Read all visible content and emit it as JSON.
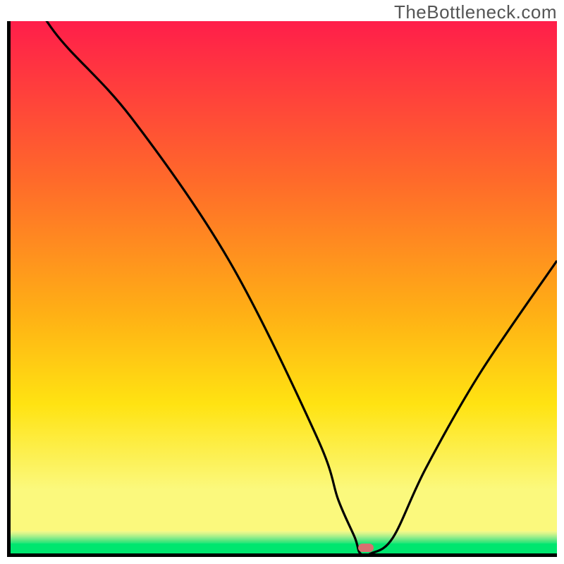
{
  "watermark": "TheBottleneck.com",
  "colors": {
    "gradient_top": "#ff1e4a",
    "gradient_mid1": "#ff6a2a",
    "gradient_mid2": "#ffb015",
    "gradient_mid3": "#ffe312",
    "gradient_bottom_yellow": "#fbf97d",
    "green_band": "#00e66f",
    "marker": "#d87070",
    "axis": "#000000"
  },
  "chart_data": {
    "type": "line",
    "title": "",
    "xlabel": "",
    "ylabel": "",
    "xlim": [
      0,
      100
    ],
    "ylim": [
      0,
      100
    ],
    "x": [
      0,
      8,
      22,
      40,
      56,
      60,
      63,
      64,
      66,
      70,
      76,
      86,
      100
    ],
    "values": [
      112,
      98,
      82,
      55,
      22,
      10,
      3,
      0,
      0,
      3,
      16,
      34,
      55
    ],
    "marker": {
      "x": 65,
      "y": 0
    },
    "gradient_stops": [
      {
        "offset": 0.0,
        "color": "#ff1e4a"
      },
      {
        "offset": 0.3,
        "color": "#ff6a2a"
      },
      {
        "offset": 0.55,
        "color": "#ffb015"
      },
      {
        "offset": 0.72,
        "color": "#ffe312"
      },
      {
        "offset": 0.88,
        "color": "#fbf97d"
      },
      {
        "offset": 0.95,
        "color": "#fbf97d"
      }
    ],
    "note": "V-shaped bottleneck curve over red-to-green vertical gradient; minimum around x≈65%."
  }
}
